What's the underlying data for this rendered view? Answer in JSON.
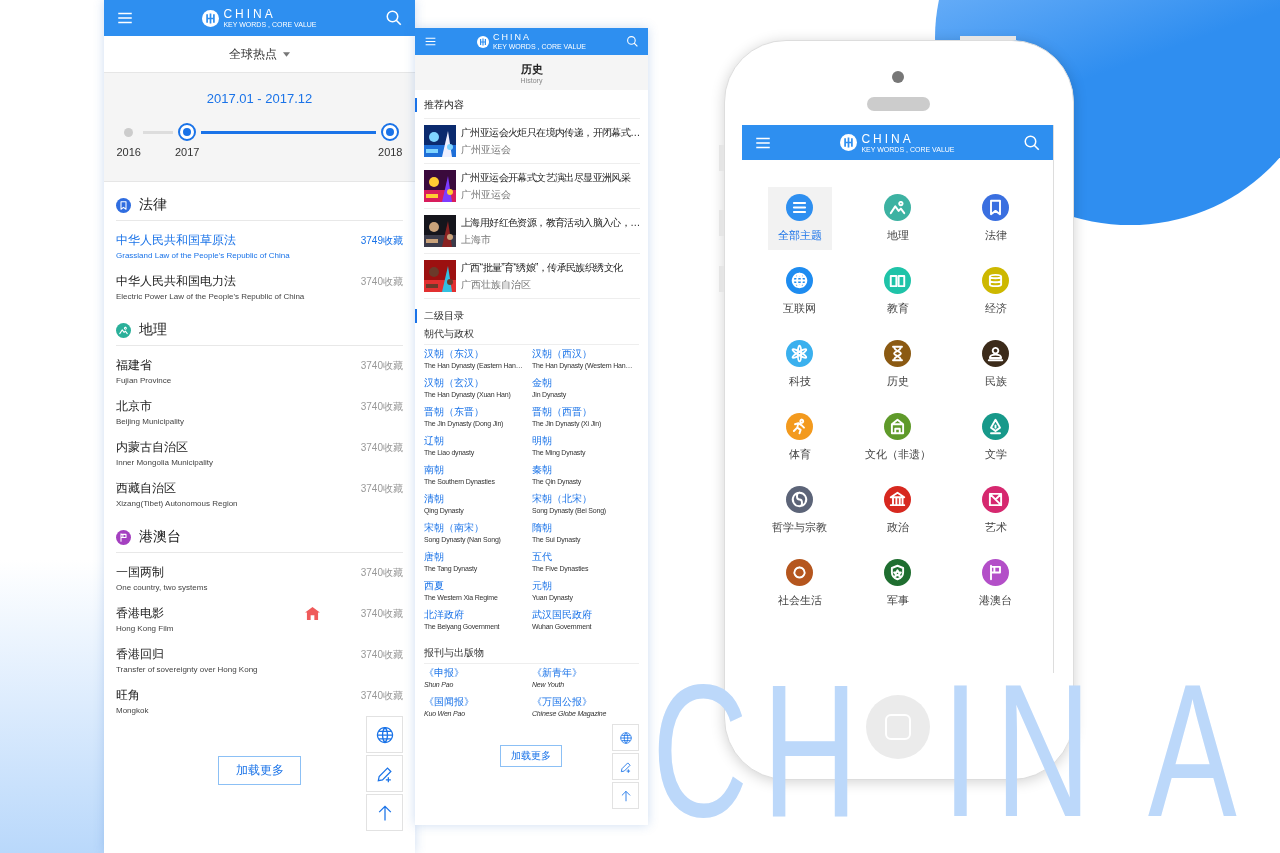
{
  "backdrop_letters": [
    "C",
    "H",
    "I",
    "N",
    "A"
  ],
  "hot_screen": {
    "logo": {
      "name": "CHINA",
      "tagline": "KEY WORDS , CORE VALUE"
    },
    "filter": "全球热点",
    "range": "2017.01 - 2017.12",
    "timeline": [
      {
        "label": "2016",
        "selected": false
      },
      {
        "label": "2017",
        "selected": true
      },
      {
        "label": "2018",
        "selected": true
      }
    ],
    "sections": [
      {
        "title": "法律",
        "kind": "bookmark",
        "color": "#2f6de0",
        "items": [
          {
            "title": "中华人民共和国草原法",
            "subtitle": "Grassland Law of the People's Republic of China",
            "count": "3749收藏",
            "selected": true
          },
          {
            "title": "中华人民共和国电力法",
            "subtitle": "Electric Power Law of the People's Republic of China",
            "count": "3740收藏",
            "selected": false
          }
        ]
      },
      {
        "title": "地理",
        "kind": "mountain",
        "color": "#2ab09a",
        "items": [
          {
            "title": "福建省",
            "subtitle": "Fujian Province",
            "count": "3740收藏",
            "selected": false
          },
          {
            "title": "北京市",
            "subtitle": "Beijing Municipality",
            "count": "3740收藏",
            "selected": false
          },
          {
            "title": "内蒙古自治区",
            "subtitle": "Inner Mongolia Municipality",
            "count": "3740收藏",
            "selected": false
          },
          {
            "title": "西藏自治区",
            "subtitle": "Xizang(Tibet) Autonomous Region",
            "count": "3740收藏",
            "selected": false
          }
        ]
      },
      {
        "title": "港澳台",
        "kind": "flag",
        "color": "#a440c0",
        "items": [
          {
            "title": "一国两制",
            "subtitle": "One country, two systems",
            "count": "3740收藏",
            "selected": false
          },
          {
            "title": "香港电影",
            "subtitle": "Hong Kong Film",
            "count": "3740收藏",
            "selected": false
          },
          {
            "title": "香港回归",
            "subtitle": "Transfer of sovereignty over Hong Kong",
            "count": "3740收藏",
            "selected": false
          },
          {
            "title": "旺角",
            "subtitle": "Mongkok",
            "count": "3740收藏",
            "selected": false
          }
        ]
      }
    ],
    "load_more": "加载更多"
  },
  "history_screen": {
    "logo": {
      "name": "CHINA",
      "tagline": "KEY WORDS , CORE VALUE"
    },
    "title": "历史",
    "subtitle": "History",
    "recommended": {
      "heading": "推荐内容",
      "items": [
        {
          "title": "广州亚运会火炬只在境内传递，开闭幕式…",
          "source": "广州亚运会"
        },
        {
          "title": "广州亚运会开幕式文艺演出尽显亚洲风采",
          "source": "广州亚运会"
        },
        {
          "title": "上海用好红色资源，教育活动入脑入心，…",
          "source": "上海市"
        },
        {
          "title": "广西“批量”育“绣娘”，传承民族织绣文化",
          "source": "广西壮族自治区"
        }
      ]
    },
    "directory": {
      "heading": "二级目录",
      "groups": [
        {
          "title": "朝代与政权",
          "italic": false,
          "items": [
            {
              "name": "汉朝（东汉）",
              "english": "The Han Dynasty (Eastern Han…"
            },
            {
              "name": "汉朝（西汉）",
              "english": "The Han Dynasty (Western Han…"
            },
            {
              "name": "汉朝（玄汉）",
              "english": "The Han Dynasty (Xuan Han)"
            },
            {
              "name": "金朝",
              "english": "Jin Dynasty"
            },
            {
              "name": "晋朝（东晋）",
              "english": "The Jin Dynasty (Dong Jin)"
            },
            {
              "name": "晋朝（西晋）",
              "english": "The Jin Dynasty (Xi Jin)"
            },
            {
              "name": "辽朝",
              "english": "The Liao dynasty"
            },
            {
              "name": "明朝",
              "english": "The Ming Dynasty"
            },
            {
              "name": "南朝",
              "english": "The Southern Dynasties"
            },
            {
              "name": "秦朝",
              "english": "The Qin Dynasty"
            },
            {
              "name": "清朝",
              "english": "Qing Dynasty"
            },
            {
              "name": "宋朝（北宋）",
              "english": "Song Dynasty (Bei Song)"
            },
            {
              "name": "宋朝（南宋）",
              "english": "Song Dynasty (Nan Song)"
            },
            {
              "name": "隋朝",
              "english": "The Sui Dynasty"
            },
            {
              "name": "唐朝",
              "english": "The Tang Dynasty"
            },
            {
              "name": "五代",
              "english": "The Five Dynasties"
            },
            {
              "name": "西夏",
              "english": "The Western Xia Regime"
            },
            {
              "name": "元朝",
              "english": "Yuan Dynasty"
            },
            {
              "name": "北洋政府",
              "english": "The Beiyang Government"
            },
            {
              "name": "武汉国民政府",
              "english": "Wuhan Government"
            }
          ]
        },
        {
          "title": "报刊与出版物",
          "italic": true,
          "items": [
            {
              "name": "《申报》",
              "english": "Shun Pao"
            },
            {
              "name": "《新青年》",
              "english": "New Youth"
            },
            {
              "name": "《国闻报》",
              "english": "Kuo Wen Pao"
            },
            {
              "name": "《万国公报》",
              "english": "Chinese Globe Magazine"
            }
          ]
        }
      ]
    },
    "load_more": "加载更多"
  },
  "topics_screen": {
    "logo": {
      "name": "CHINA",
      "tagline": "KEY WORDS , CORE VALUE"
    },
    "items": [
      {
        "label": "全部主题",
        "kind": "menu",
        "color": "#2e8ff0",
        "selected": true
      },
      {
        "label": "地理",
        "kind": "mountain",
        "color": "#3db2a2",
        "selected": false
      },
      {
        "label": "法律",
        "kind": "bookmark",
        "color": "#3a6fe0",
        "selected": false
      },
      {
        "label": "互联网",
        "kind": "globe",
        "color": "#1e8cf0",
        "selected": false
      },
      {
        "label": "教育",
        "kind": "book",
        "color": "#1fc3a8",
        "selected": false
      },
      {
        "label": "经济",
        "kind": "coins",
        "color": "#cdb800",
        "selected": false
      },
      {
        "label": "科技",
        "kind": "atom",
        "color": "#3ab0ee",
        "selected": false
      },
      {
        "label": "历史",
        "kind": "hourglass",
        "color": "#8b5a12",
        "selected": false
      },
      {
        "label": "民族",
        "kind": "person",
        "color": "#3c2b1a",
        "selected": false
      },
      {
        "label": "体育",
        "kind": "runner",
        "color": "#f39a1e",
        "selected": false
      },
      {
        "label": "文化（非遗）",
        "kind": "building",
        "color": "#5f9a2a",
        "selected": false
      },
      {
        "label": "文学",
        "kind": "nib",
        "color": "#17998a",
        "selected": false
      },
      {
        "label": "哲学与宗教",
        "kind": "yinyang",
        "color": "#5c6478",
        "selected": false
      },
      {
        "label": "政治",
        "kind": "columns",
        "color": "#d7281f",
        "selected": false
      },
      {
        "label": "艺术",
        "kind": "frame",
        "color": "#d6286f",
        "selected": false
      },
      {
        "label": "社会生活",
        "kind": "ring",
        "color": "#b5561e",
        "selected": false
      },
      {
        "label": "军事",
        "kind": "shield",
        "color": "#1f6e30",
        "selected": false
      },
      {
        "label": "港澳台",
        "kind": "flag",
        "color": "#b34fc8",
        "selected": false
      }
    ]
  }
}
